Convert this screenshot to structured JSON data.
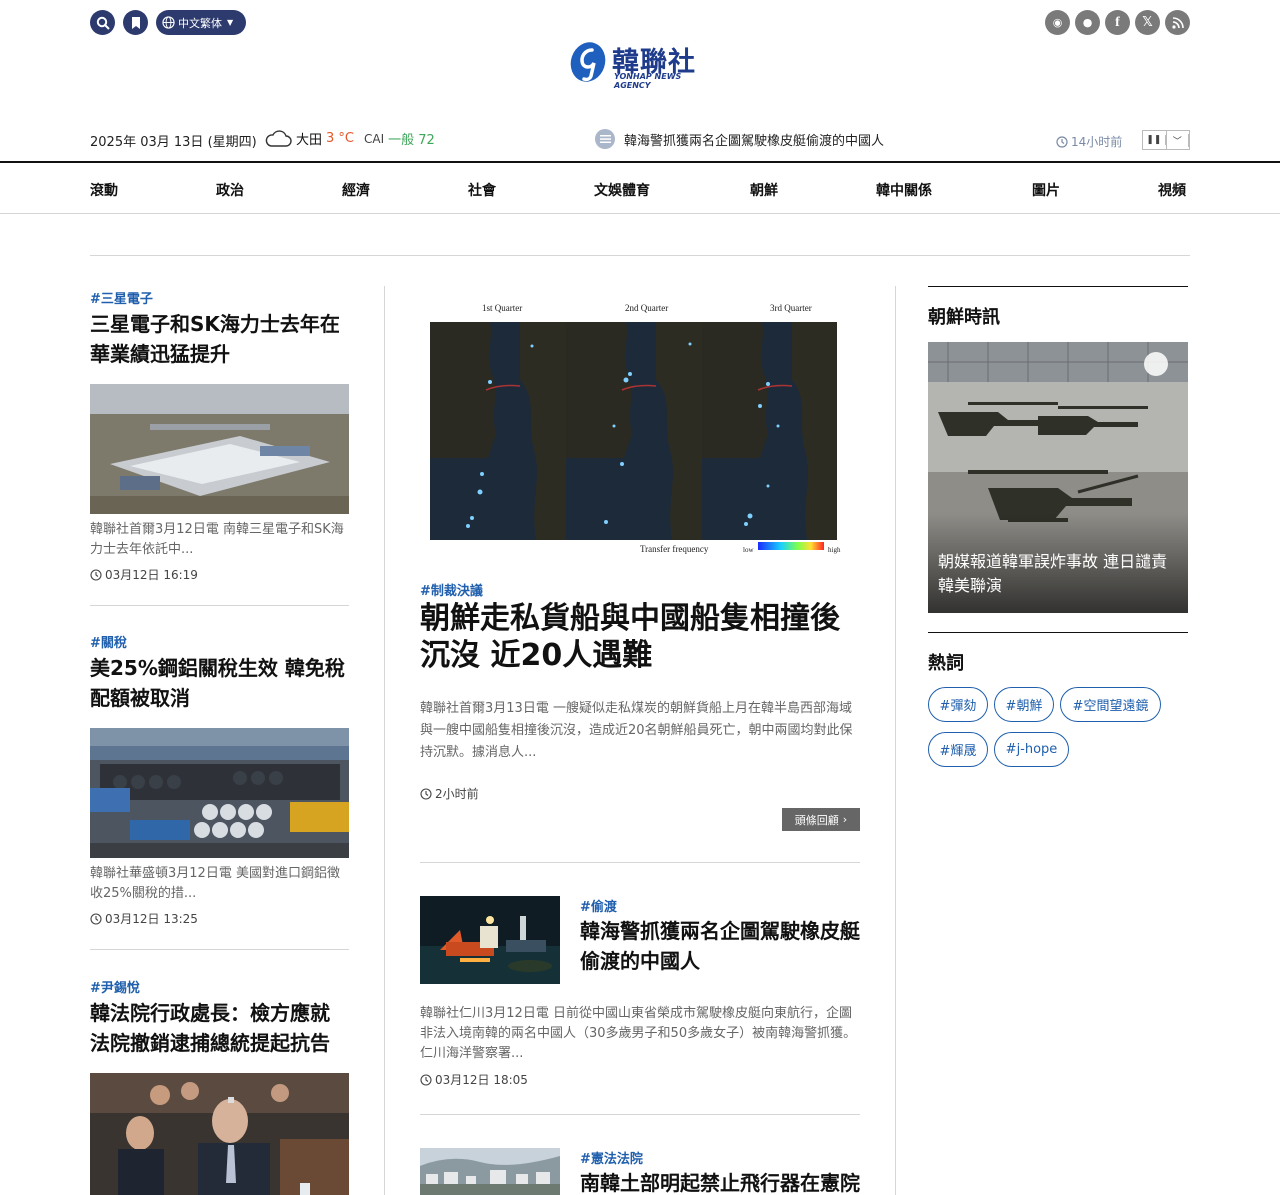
{
  "header": {
    "lang_label": "中文繁体",
    "logo_cn": "韓聯社",
    "logo_en": "YONHAP NEWS AGENCY"
  },
  "info": {
    "date": "2025年 03月 13日 (星期四)",
    "city": "大田",
    "temp": "3 °C",
    "cai_label": "CAI",
    "cai_value": "一般 72",
    "ticker_text": "韓海警抓獲兩名企圖駕駛橡皮艇偷渡的中國人",
    "ticker_time": "14小时前"
  },
  "nav": [
    "滾動",
    "政治",
    "經濟",
    "社會",
    "文娛體育",
    "朝鮮",
    "韓中關係",
    "圖片",
    "視頻"
  ],
  "left_articles": [
    {
      "tag": "#三星電子",
      "title": "三星電子和SK海力士去年在華業績迅猛提升",
      "summary": "韓聯社首爾3月12日電 南韓三星電子和SK海力士去年依託中...",
      "time": "03月12日 16:19"
    },
    {
      "tag": "#關稅",
      "title": "美25%鋼鋁關稅生效 韓免稅配額被取消",
      "summary": "韓聯社華盛頓3月12日電 美國對進口鋼鋁徵收25%關稅的措...",
      "time": "03月12日 13:25"
    },
    {
      "tag": "#尹錫悅",
      "title": "韓法院行政處長：檢方應就法院撤銷逮捕總統提起抗告",
      "summary": "",
      "time": ""
    }
  ],
  "lead": {
    "map_labels": [
      "1st Quarter",
      "2nd Quarter",
      "3rd Quarter"
    ],
    "legend_label": "Transfer frequency",
    "legend_low": "low",
    "legend_high": "high",
    "tag": "#制裁決議",
    "title": "朝鮮走私貨船與中國船隻相撞後沉沒 近20人遇難",
    "summary": "韓聯社首爾3月13日電 一艘疑似走私煤炭的朝鮮貨船上月在韓半島西部海域與一艘中國船隻相撞後沉沒，造成近20名朝鮮船員死亡，朝中兩國均對此保持沉默。據消息人...",
    "time": "2小时前",
    "headline_btn": "頭條回顧"
  },
  "mid_articles": [
    {
      "tag": "#偷渡",
      "title": "韓海警抓獲兩名企圖駕駛橡皮艇偷渡的中國人",
      "summary": "韓聯社仁川3月12日電 日前從中國山東省榮成市駕駛橡皮艇向東航行，企圖非法入境南韓的兩名中國人（30多歲男子和50多歲女子）被南韓海警抓獲。仁川海洋警察署...",
      "time": "03月12日 18:05"
    },
    {
      "tag": "#憲法法院",
      "title": "南韓土部明起禁止飛行器在憲院",
      "summary": "",
      "time": ""
    }
  ],
  "right": {
    "section1_title": "朝鮮時訊",
    "feature_caption": "朝媒報道韓軍誤炸事故 連日譴責韓美聯演",
    "section2_title": "熱詞",
    "keywords": [
      "#彈劾",
      "#朝鮮",
      "#空間望遠鏡",
      "#輝晟",
      "#j-hope"
    ]
  },
  "colors": {
    "brand_navy": "#2c3a6e",
    "link_blue": "#1f5fad",
    "temp_orange": "#e4582a",
    "cai_green": "#3ea65a"
  }
}
